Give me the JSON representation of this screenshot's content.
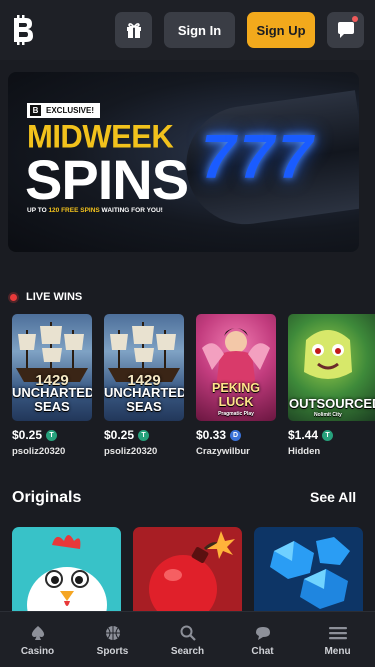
{
  "header": {
    "signin_label": "Sign In",
    "signup_label": "Sign Up"
  },
  "banner": {
    "badge": "EXCLUSIVE!",
    "line1": "MIDWEEK",
    "line2": "SPINS",
    "sub_prefix": "UP TO ",
    "sub_highlight": "120 FREE SPINS",
    "sub_suffix": " WAITING FOR YOU!",
    "reels": [
      "7",
      "7",
      "7"
    ]
  },
  "live_wins": {
    "title": "LIVE WINS",
    "items": [
      {
        "game": "UNCHARTED SEAS",
        "amount": "$0.25",
        "coin": "T",
        "user": "psoliz20320"
      },
      {
        "game": "UNCHARTED SEAS",
        "amount": "$0.25",
        "coin": "T",
        "user": "psoliz20320"
      },
      {
        "game": "PEKING LUCK",
        "provider": "Pragmatic Play",
        "amount": "$0.33",
        "coin": "D",
        "user": "Crazywilbur"
      },
      {
        "game": "OUTSOURCED",
        "provider": "Nolimit City",
        "amount": "$1.44",
        "coin": "T",
        "user": "Hidden"
      }
    ]
  },
  "originals": {
    "title": "Originals",
    "see_all": "See All"
  },
  "nav": {
    "items": [
      {
        "label": "Casino"
      },
      {
        "label": "Sports"
      },
      {
        "label": "Search"
      },
      {
        "label": "Chat"
      },
      {
        "label": "Menu"
      }
    ]
  },
  "colors": {
    "accent": "#f2a91c",
    "bg": "#1a1c22",
    "panel": "#3a3d45",
    "live": "#e83a3a"
  }
}
